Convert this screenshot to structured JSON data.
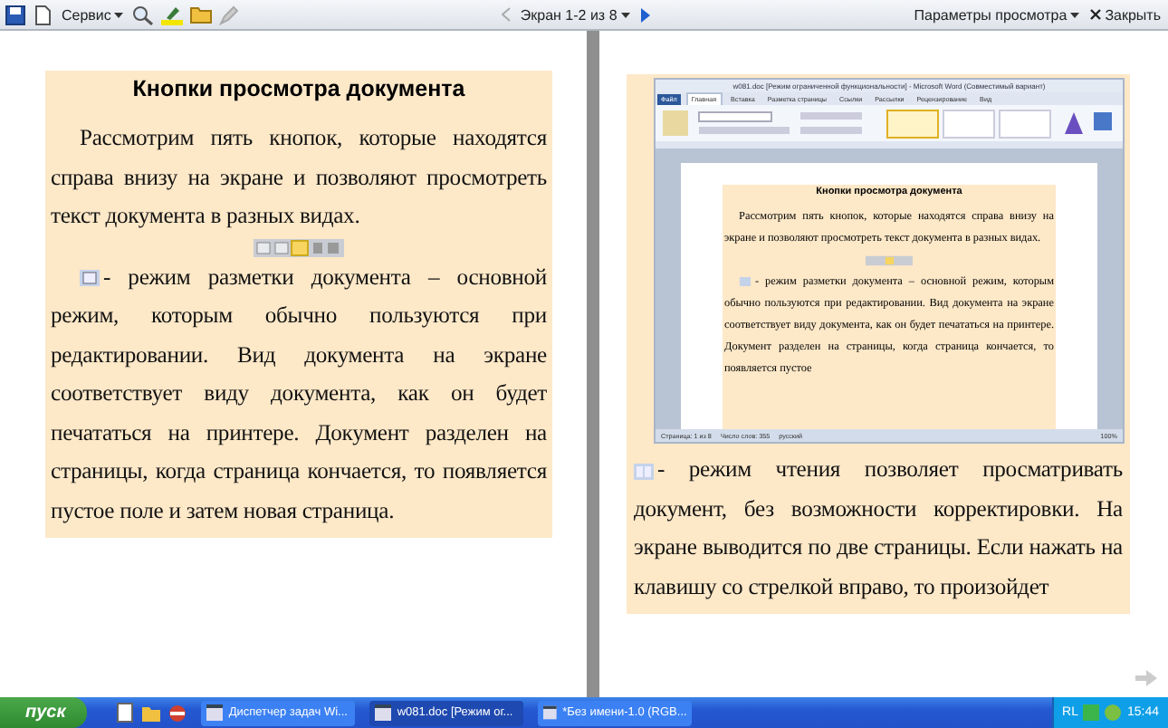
{
  "toolbar": {
    "service_menu": "Сервис",
    "screen_label": "Экран 1-2 из 8",
    "view_options": "Параметры просмотра",
    "close": "Закрыть"
  },
  "left_page": {
    "heading": "Кнопки просмотра документа",
    "blocks": [
      {
        "kind": "paragraph",
        "text": "Рассмотрим пять кнопок, которые находятся справа внизу на экране и позволяют просмотреть текст документа в разных видах."
      },
      {
        "kind": "view_buttons"
      },
      {
        "kind": "icon_paragraph",
        "text": "- режим разметки документа – основной режим, которым обычно пользуются при редактировании. Вид документа на экране соответствует виду документа, как он будет печататься на принтере. Документ разделен на страницы, когда страница кончается, то появляется пустое поле и затем новая страница."
      }
    ]
  },
  "right_page": {
    "inner_window": {
      "title": "w081.doc [Режим ограниченной функциональности] - Microsoft Word (Совместимый вариант)",
      "tabs": [
        {
          "label": "Файл",
          "selected": false
        },
        {
          "label": "Главная",
          "selected": true
        },
        {
          "label": "Вставка",
          "selected": false
        },
        {
          "label": "Разметка страницы",
          "selected": false
        },
        {
          "label": "Ссылки",
          "selected": false
        },
        {
          "label": "Рассылки",
          "selected": false
        },
        {
          "label": "Рецензирование",
          "selected": false
        },
        {
          "label": "Вид",
          "selected": false
        }
      ],
      "heading": "Кнопки просмотра документа",
      "blocks": [
        {
          "kind": "paragraph",
          "text": "Рассмотрим пять кнопок, которые находятся справа внизу на экране и позволяют просмотреть текст документа в разных видах."
        },
        {
          "kind": "view_buttons"
        },
        {
          "kind": "icon_paragraph",
          "text": "- режим разметки документа – основной режим, которым обычно пользуются при редактировании. Вид документа на экране соответствует виду документа, как он будет печататься на принтере. Документ разделен на страницы, когда страница кончается, то появляется пустое"
        }
      ],
      "status": [
        "Страница: 1 из 8",
        "Число слов: 355",
        "русский"
      ],
      "zoom": "100%"
    },
    "blocks": [
      {
        "kind": "icon_paragraph",
        "text": "- режим чтения позволяет просматривать документ, без возможности корректировки. На экране выводится по две страницы. Если нажать на клавишу со стрелкой вправо, то произойдет"
      }
    ]
  },
  "taskbar": {
    "start": "пуск",
    "tasks": [
      {
        "label": "Диспетчер задач Wi...",
        "selected": false
      },
      {
        "label": "w081.doc [Режим ог...",
        "selected": true
      },
      {
        "label": "*Без имени-1.0 (RGB...",
        "selected": false
      }
    ],
    "language": "RL",
    "time": "15:44"
  }
}
